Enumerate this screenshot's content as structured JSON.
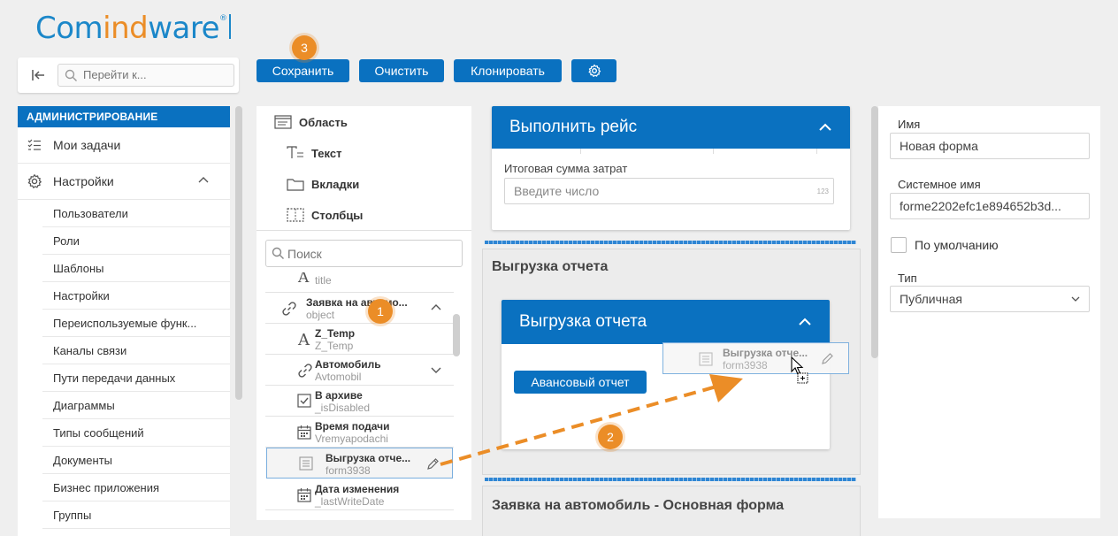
{
  "logo": {
    "part1": "Com",
    "part2": "ind",
    "part3": "ware",
    "reg": "®"
  },
  "top_search": {
    "placeholder": "Перейти к..."
  },
  "toolbar": {
    "save": "Сохранить",
    "clear": "Очистить",
    "clone": "Клонировать"
  },
  "badges": {
    "one": "1",
    "two": "2",
    "three": "3"
  },
  "sidebar": {
    "header": "АДМИНИСТРИРОВАНИЕ",
    "my_tasks": "Мои задачи",
    "settings": "Настройки",
    "sub_items": [
      "Пользователи",
      "Роли",
      "Шаблоны",
      "Настройки",
      "Переиспользуемые функ...",
      "Каналы связи",
      "Пути передачи данных",
      "Диаграммы",
      "Типы сообщений",
      "Документы",
      "Бизнес приложения",
      "Группы"
    ]
  },
  "palette": {
    "area": "Область",
    "text": "Текст",
    "tabs": "Вкладки",
    "columns": "Столбцы",
    "search_placeholder": "Поиск",
    "fields": [
      {
        "name": "",
        "sys": "title"
      },
      {
        "name": "Заявка на автомо...",
        "sys": "object"
      },
      {
        "name": "Z_Temp",
        "sys": "Z_Temp"
      },
      {
        "name": "Автомобиль",
        "sys": "Avtomobil"
      },
      {
        "name": "В архиве",
        "sys": "_isDisabled"
      },
      {
        "name": "Время подачи",
        "sys": "Vremyapodachi"
      },
      {
        "name": "Выгрузка отче...",
        "sys": "form3938"
      },
      {
        "name": "Дата изменения",
        "sys": "_lastWriteDate"
      }
    ]
  },
  "canvas": {
    "card1_title": "Выполнить рейс",
    "total_label": "Итоговая сумма затрат",
    "total_placeholder": "Введите число",
    "total_suffix": "123",
    "zone1_title": "Выгрузка отчета",
    "card2_title": "Выгрузка отчета",
    "report_button": "Авансовый отчет",
    "ghost_name": "Выгрузка отче...",
    "ghost_sys": "form3938",
    "zone2_title": "Заявка на автомобиль - Основная форма"
  },
  "props": {
    "name_label": "Имя",
    "name_value": "Новая форма",
    "sysname_label": "Системное имя",
    "sysname_value": "forme2202efc1e894652b3d...",
    "default_label": "По умолчанию",
    "type_label": "Тип",
    "type_value": "Публичная"
  },
  "colors": {
    "primary": "#0a71c0",
    "accent": "#eb8d27",
    "background": "#efefef"
  }
}
